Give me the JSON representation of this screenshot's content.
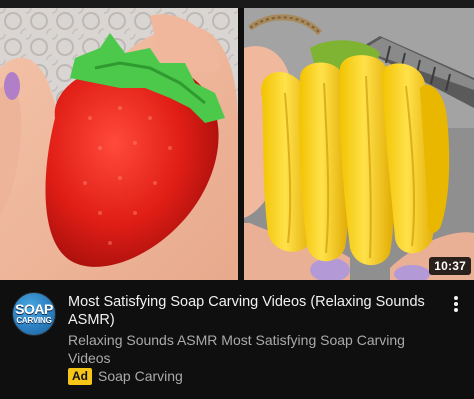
{
  "video": {
    "duration": "10:37",
    "title": "Most Satisfying Soap Carving Videos (Relaxing Sounds ASMR)",
    "description": "Relaxing Sounds ASMR Most Satisfying Soap Carving Videos",
    "ad_label": "Ad",
    "advertiser": "Soap Carving"
  },
  "channel": {
    "avatar_line1": "SOAP",
    "avatar_line2": "CARVING"
  },
  "icons": {
    "more": "more-vert-icon"
  },
  "colors": {
    "background": "#0f0f0f",
    "ad_badge": "#f5c518",
    "secondary_text": "#aaaaaa"
  }
}
